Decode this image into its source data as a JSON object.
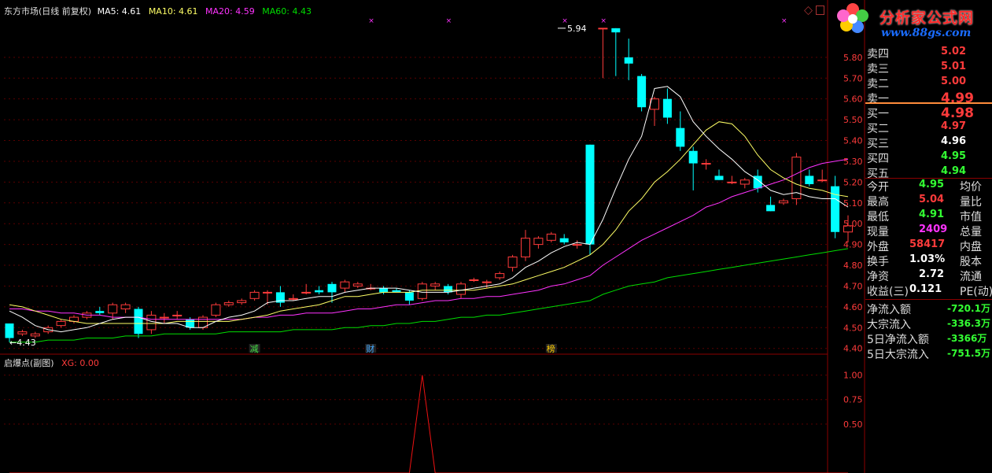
{
  "colors": {
    "up": "#ff3b3b",
    "down": "#00ffff",
    "ma5": "#ffffff",
    "ma10": "#ffff66",
    "ma20": "#ff33ff",
    "ma60": "#00dd00",
    "grid": "#8b0000"
  },
  "header": {
    "title": "东方市场(日线 前复权)",
    "ma5": "MA5: 4.61",
    "ma10": "MA10: 4.61",
    "ma20": "MA20: 4.59",
    "ma60": "MA60: 4.43"
  },
  "sub_header": {
    "title": "启爆点(副图)",
    "xg": "XG: 0.00"
  },
  "logo": {
    "text": "分析家公式网",
    "url": "www.88gs.com"
  },
  "annotations": {
    "high": "5.94",
    "low": "4.43",
    "event1": "减",
    "event2": "财",
    "event3": "榜"
  },
  "chart_data": [
    {
      "type": "candlestick",
      "title": "东方市场(日线 前复权)",
      "ylim": [
        4.38,
        6.0
      ],
      "y_ticks": [
        "5.80",
        "5.70",
        "5.60",
        "5.50",
        "5.40",
        "5.30",
        "5.20",
        "5.10",
        "5.00",
        "4.90",
        "4.80",
        "4.70",
        "4.60",
        "4.50",
        "4.40"
      ],
      "ohlc": [
        [
          4.52,
          4.52,
          4.43,
          4.45
        ],
        [
          4.47,
          4.49,
          4.46,
          4.48
        ],
        [
          4.46,
          4.48,
          4.45,
          4.47
        ],
        [
          4.48,
          4.51,
          4.47,
          4.5
        ],
        [
          4.51,
          4.54,
          4.5,
          4.53
        ],
        [
          4.53,
          4.56,
          4.52,
          4.55
        ],
        [
          4.55,
          4.58,
          4.54,
          4.57
        ],
        [
          4.58,
          4.6,
          4.56,
          4.57
        ],
        [
          4.57,
          4.62,
          4.54,
          4.61
        ],
        [
          4.59,
          4.62,
          4.57,
          4.61
        ],
        [
          4.59,
          4.6,
          4.45,
          4.47
        ],
        [
          4.49,
          4.58,
          4.47,
          4.56
        ],
        [
          4.55,
          4.57,
          4.52,
          4.55
        ],
        [
          4.56,
          4.58,
          4.54,
          4.56
        ],
        [
          4.54,
          4.55,
          4.49,
          4.5
        ],
        [
          4.5,
          4.56,
          4.49,
          4.55
        ],
        [
          4.56,
          4.62,
          4.55,
          4.61
        ],
        [
          4.61,
          4.63,
          4.6,
          4.62
        ],
        [
          4.62,
          4.64,
          4.61,
          4.63
        ],
        [
          4.64,
          4.68,
          4.63,
          4.67
        ],
        [
          4.67,
          4.68,
          4.61,
          4.67
        ],
        [
          4.67,
          4.7,
          4.6,
          4.62
        ],
        [
          4.64,
          4.66,
          4.63,
          4.64
        ],
        [
          4.67,
          4.71,
          4.66,
          4.67
        ],
        [
          4.68,
          4.7,
          4.66,
          4.67
        ],
        [
          4.71,
          4.72,
          4.62,
          4.67
        ],
        [
          4.69,
          4.73,
          4.67,
          4.72
        ],
        [
          4.7,
          4.72,
          4.69,
          4.71
        ],
        [
          4.69,
          4.71,
          4.68,
          4.69
        ],
        [
          4.69,
          4.7,
          4.66,
          4.67
        ],
        [
          4.68,
          4.69,
          4.67,
          4.67
        ],
        [
          4.67,
          4.68,
          4.61,
          4.63
        ],
        [
          4.64,
          4.72,
          4.63,
          4.71
        ],
        [
          4.7,
          4.72,
          4.68,
          4.71
        ],
        [
          4.7,
          4.71,
          4.66,
          4.67
        ],
        [
          4.66,
          4.72,
          4.64,
          4.71
        ],
        [
          4.73,
          4.74,
          4.72,
          4.73
        ],
        [
          4.72,
          4.73,
          4.69,
          4.72
        ],
        [
          4.74,
          4.77,
          4.73,
          4.76
        ],
        [
          4.79,
          4.85,
          4.77,
          4.84
        ],
        [
          4.84,
          4.97,
          4.82,
          4.93
        ],
        [
          4.9,
          4.94,
          4.88,
          4.93
        ],
        [
          4.92,
          4.96,
          4.91,
          4.95
        ],
        [
          4.93,
          4.95,
          4.9,
          4.91
        ],
        [
          4.9,
          4.92,
          4.88,
          4.9
        ],
        [
          5.38,
          5.38,
          4.85,
          4.9
        ],
        [
          5.94,
          5.94,
          5.7,
          5.94
        ],
        [
          5.94,
          5.94,
          5.71,
          5.92
        ],
        [
          5.8,
          5.89,
          5.69,
          5.77
        ],
        [
          5.71,
          5.72,
          5.54,
          5.56
        ],
        [
          5.55,
          5.61,
          5.47,
          5.6
        ],
        [
          5.6,
          5.65,
          5.48,
          5.51
        ],
        [
          5.46,
          5.54,
          5.35,
          5.37
        ],
        [
          5.35,
          5.37,
          5.16,
          5.29
        ],
        [
          5.29,
          5.31,
          5.26,
          5.29
        ],
        [
          5.23,
          5.26,
          5.21,
          5.21
        ],
        [
          5.2,
          5.23,
          5.19,
          5.2
        ],
        [
          5.19,
          5.22,
          5.17,
          5.21
        ],
        [
          5.23,
          5.26,
          5.15,
          5.17
        ],
        [
          5.09,
          5.13,
          5.06,
          5.06
        ],
        [
          5.1,
          5.12,
          5.09,
          5.11
        ],
        [
          5.12,
          5.34,
          5.09,
          5.32
        ],
        [
          5.23,
          5.26,
          5.18,
          5.19
        ],
        [
          5.21,
          5.26,
          5.2,
          5.21
        ],
        [
          5.18,
          5.23,
          4.93,
          4.96
        ],
        [
          4.96,
          5.04,
          4.91,
          4.99
        ]
      ],
      "ma5": [
        4.58,
        4.55,
        4.51,
        4.49,
        4.48,
        4.49,
        4.5,
        4.52,
        4.54,
        4.55,
        4.55,
        4.53,
        4.52,
        4.52,
        4.5,
        4.5,
        4.53,
        4.55,
        4.56,
        4.58,
        4.62,
        4.63,
        4.63,
        4.64,
        4.65,
        4.65,
        4.67,
        4.68,
        4.69,
        4.69,
        4.69,
        4.68,
        4.67,
        4.67,
        4.67,
        4.68,
        4.69,
        4.7,
        4.71,
        4.74,
        4.79,
        4.82,
        4.86,
        4.89,
        4.91,
        4.9,
        5.02,
        5.17,
        5.31,
        5.42,
        5.65,
        5.66,
        5.61,
        5.49,
        5.42,
        5.36,
        5.31,
        5.25,
        5.21,
        5.16,
        5.14,
        5.15,
        5.13,
        5.12,
        5.12,
        5.08
      ],
      "ma10": [
        4.61,
        4.6,
        4.58,
        4.56,
        4.54,
        4.53,
        4.52,
        4.52,
        4.52,
        4.52,
        4.52,
        4.52,
        4.52,
        4.53,
        4.53,
        4.53,
        4.53,
        4.53,
        4.54,
        4.55,
        4.56,
        4.58,
        4.59,
        4.6,
        4.61,
        4.63,
        4.65,
        4.65,
        4.66,
        4.67,
        4.67,
        4.67,
        4.68,
        4.68,
        4.68,
        4.68,
        4.68,
        4.69,
        4.7,
        4.71,
        4.73,
        4.75,
        4.77,
        4.79,
        4.82,
        4.85,
        4.9,
        4.97,
        5.06,
        5.12,
        5.2,
        5.25,
        5.31,
        5.38,
        5.45,
        5.49,
        5.48,
        5.42,
        5.33,
        5.26,
        5.22,
        5.19,
        5.17,
        5.16,
        5.14,
        5.13
      ],
      "ma20": [
        4.59,
        4.59,
        4.58,
        4.58,
        4.57,
        4.57,
        4.56,
        4.56,
        4.55,
        4.55,
        4.55,
        4.54,
        4.54,
        4.54,
        4.54,
        4.54,
        4.54,
        4.54,
        4.54,
        4.55,
        4.55,
        4.56,
        4.56,
        4.57,
        4.57,
        4.57,
        4.58,
        4.59,
        4.59,
        4.6,
        4.61,
        4.61,
        4.62,
        4.63,
        4.63,
        4.64,
        4.64,
        4.65,
        4.65,
        4.66,
        4.67,
        4.68,
        4.7,
        4.71,
        4.73,
        4.75,
        4.8,
        4.84,
        4.88,
        4.92,
        4.95,
        4.98,
        5.01,
        5.04,
        5.08,
        5.1,
        5.13,
        5.15,
        5.17,
        5.19,
        5.21,
        5.24,
        5.27,
        5.29,
        5.3,
        5.31
      ],
      "ma60": [
        4.43,
        4.43,
        4.43,
        4.44,
        4.44,
        4.44,
        4.45,
        4.45,
        4.45,
        4.46,
        4.46,
        4.46,
        4.47,
        4.47,
        4.47,
        4.47,
        4.47,
        4.48,
        4.48,
        4.48,
        4.48,
        4.48,
        4.49,
        4.49,
        4.49,
        4.49,
        4.5,
        4.5,
        4.51,
        4.51,
        4.52,
        4.52,
        4.53,
        4.53,
        4.54,
        4.55,
        4.55,
        4.56,
        4.56,
        4.57,
        4.58,
        4.59,
        4.6,
        4.61,
        4.62,
        4.63,
        4.66,
        4.68,
        4.7,
        4.71,
        4.72,
        4.74,
        4.75,
        4.76,
        4.77,
        4.78,
        4.79,
        4.8,
        4.81,
        4.82,
        4.83,
        4.84,
        4.85,
        4.86,
        4.87,
        4.88
      ],
      "markers": [
        {
          "index": 66,
          "text": "5.94",
          "kind": "high"
        },
        {
          "index": 0,
          "text": "4.43",
          "kind": "low"
        }
      ],
      "event_labels": [
        {
          "index": 19,
          "text": "减"
        },
        {
          "index": 28,
          "text": "财"
        },
        {
          "index": 42,
          "text": "榜"
        }
      ]
    },
    {
      "type": "line",
      "title": "启爆点(副图)",
      "series": [
        {
          "name": "XG",
          "values": [
            0,
            0,
            0,
            0,
            0,
            0,
            0,
            0,
            0,
            0,
            0,
            0,
            0,
            0,
            0,
            0,
            0,
            0,
            0,
            0,
            0,
            0,
            0,
            0,
            0,
            0,
            0,
            0,
            0,
            0,
            0,
            0,
            0,
            0,
            0,
            0,
            0,
            0,
            0,
            0,
            0,
            0,
            0,
            0,
            0,
            0,
            0,
            0,
            0,
            0,
            0,
            0,
            0,
            0,
            0,
            0,
            0,
            0,
            0,
            0,
            0,
            0,
            0,
            0,
            0,
            0
          ]
        }
      ],
      "xg_peak_index": 32,
      "ylim": [
        0,
        1.15
      ],
      "y_ticks": [
        "1.00",
        "0.75",
        "0.50"
      ]
    }
  ],
  "quote": {
    "sell": [
      {
        "label": "卖四",
        "price": "5.02"
      },
      {
        "label": "卖三",
        "price": "5.01"
      },
      {
        "label": "卖二",
        "price": "5.00"
      },
      {
        "label": "卖一",
        "price": "4.99"
      }
    ],
    "buy": [
      {
        "label": "买一",
        "price": "4.98"
      },
      {
        "label": "买二",
        "price": "4.97"
      },
      {
        "label": "买三",
        "price": "4.96"
      },
      {
        "label": "买四",
        "price": "4.95"
      },
      {
        "label": "买五",
        "price": "4.94"
      }
    ],
    "stats": [
      {
        "l": "今开",
        "v": "4.95",
        "r": "均价",
        "vc": "#33ff33"
      },
      {
        "l": "最高",
        "v": "5.04",
        "r": "量比",
        "vc": "#ff3b3b"
      },
      {
        "l": "最低",
        "v": "4.91",
        "r": "市值",
        "vc": "#33ff33"
      },
      {
        "l": "现量",
        "v": "2409",
        "r": "总量",
        "vc": "#ff33ff"
      },
      {
        "l": "外盘",
        "v": "58417",
        "r": "内盘",
        "vc": "#ff3b3b"
      },
      {
        "l": "换手",
        "v": "1.03%",
        "r": "股本",
        "vc": "#ffffff"
      },
      {
        "l": "净资",
        "v": "2.72",
        "r": "流通",
        "vc": "#ffffff"
      },
      {
        "l": "收益(三)",
        "v": "0.121",
        "r": "PE(动)",
        "vc": "#ffffff"
      }
    ],
    "flows": [
      {
        "l": "净流入额",
        "v": "-720.1万"
      },
      {
        "l": "大宗流入",
        "v": "-336.3万"
      },
      {
        "l": "5日净流入额",
        "v": "-3366万"
      },
      {
        "l": "5日大宗流入",
        "v": "-751.5万"
      }
    ]
  }
}
